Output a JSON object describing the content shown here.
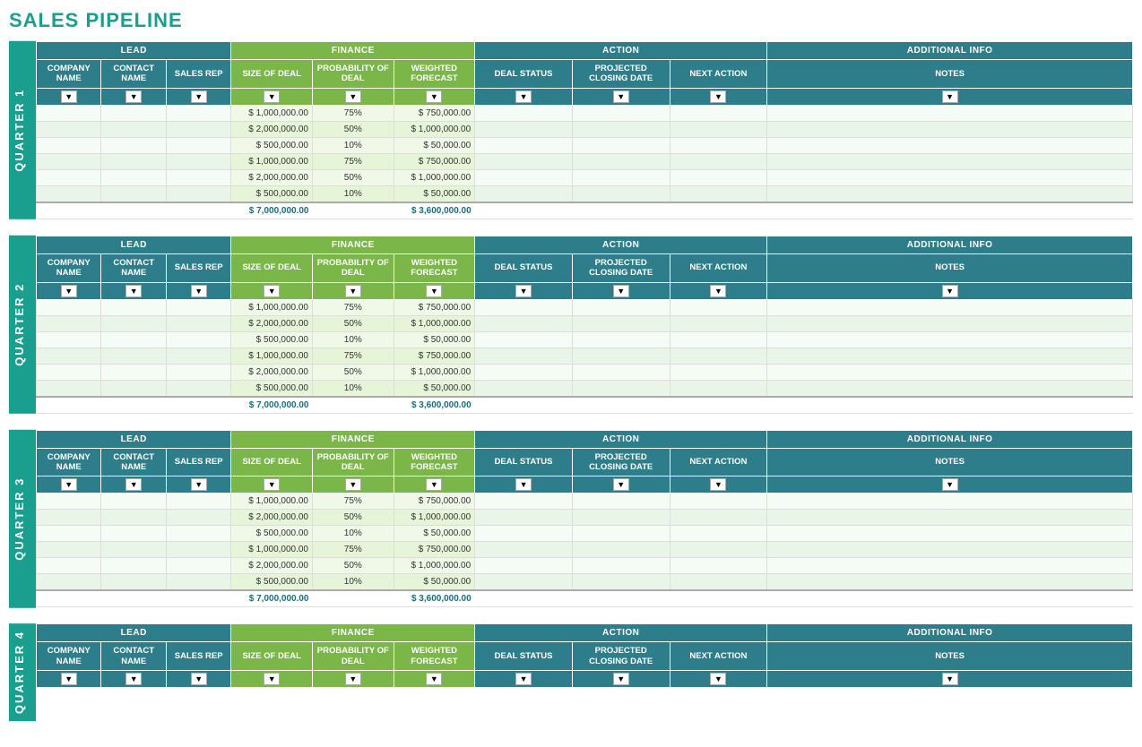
{
  "page": {
    "title": "SALES PIPELINE"
  },
  "headers": {
    "lead_group": "LEAD",
    "finance_group": "FINANCE",
    "action_group": "ACTION",
    "additional_group": "ADDITIONAL INFO",
    "company_name": "COMPANY NAME",
    "contact_name": "CONTACT NAME",
    "sales_rep": "SALES REP",
    "size_of_deal": "SIZE OF DEAL",
    "probability_of_deal": "PROBABILITY OF DEAL",
    "weighted_forecast": "WEIGHTED FORECAST",
    "deal_status": "DEAL STATUS",
    "projected_closing_date": "PROJECTED CLOSING DATE",
    "next_action": "NEXT ACTION",
    "notes": "NOTES"
  },
  "quarters": [
    {
      "label": "QUARTER 1",
      "rows": [
        {
          "size": "$ 1,000,000.00",
          "probability": "75%",
          "weighted": "$ 750,000.00"
        },
        {
          "size": "$ 2,000,000.00",
          "probability": "50%",
          "weighted": "$ 1,000,000.00"
        },
        {
          "size": "$ 500,000.00",
          "probability": "10%",
          "weighted": "$ 50,000.00"
        },
        {
          "size": "$ 1,000,000.00",
          "probability": "75%",
          "weighted": "$ 750,000.00"
        },
        {
          "size": "$ 2,000,000.00",
          "probability": "50%",
          "weighted": "$ 1,000,000.00"
        },
        {
          "size": "$ 500,000.00",
          "probability": "10%",
          "weighted": "$ 50,000.00"
        }
      ],
      "total_size": "$ 7,000,000.00",
      "total_weighted": "$ 3,600,000.00"
    },
    {
      "label": "QUARTER 2",
      "rows": [
        {
          "size": "$ 1,000,000.00",
          "probability": "75%",
          "weighted": "$ 750,000.00"
        },
        {
          "size": "$ 2,000,000.00",
          "probability": "50%",
          "weighted": "$ 1,000,000.00"
        },
        {
          "size": "$ 500,000.00",
          "probability": "10%",
          "weighted": "$ 50,000.00"
        },
        {
          "size": "$ 1,000,000.00",
          "probability": "75%",
          "weighted": "$ 750,000.00"
        },
        {
          "size": "$ 2,000,000.00",
          "probability": "50%",
          "weighted": "$ 1,000,000.00"
        },
        {
          "size": "$ 500,000.00",
          "probability": "10%",
          "weighted": "$ 50,000.00"
        }
      ],
      "total_size": "$ 7,000,000.00",
      "total_weighted": "$ 3,600,000.00"
    },
    {
      "label": "QUARTER 3",
      "rows": [
        {
          "size": "$ 1,000,000.00",
          "probability": "75%",
          "weighted": "$ 750,000.00"
        },
        {
          "size": "$ 2,000,000.00",
          "probability": "50%",
          "weighted": "$ 1,000,000.00"
        },
        {
          "size": "$ 500,000.00",
          "probability": "10%",
          "weighted": "$ 50,000.00"
        },
        {
          "size": "$ 1,000,000.00",
          "probability": "75%",
          "weighted": "$ 750,000.00"
        },
        {
          "size": "$ 2,000,000.00",
          "probability": "50%",
          "weighted": "$ 1,000,000.00"
        },
        {
          "size": "$ 500,000.00",
          "probability": "10%",
          "weighted": "$ 50,000.00"
        }
      ],
      "total_size": "$ 7,000,000.00",
      "total_weighted": "$ 3,600,000.00"
    },
    {
      "label": "QUARTER 4",
      "rows": [],
      "total_size": "",
      "total_weighted": ""
    }
  ]
}
